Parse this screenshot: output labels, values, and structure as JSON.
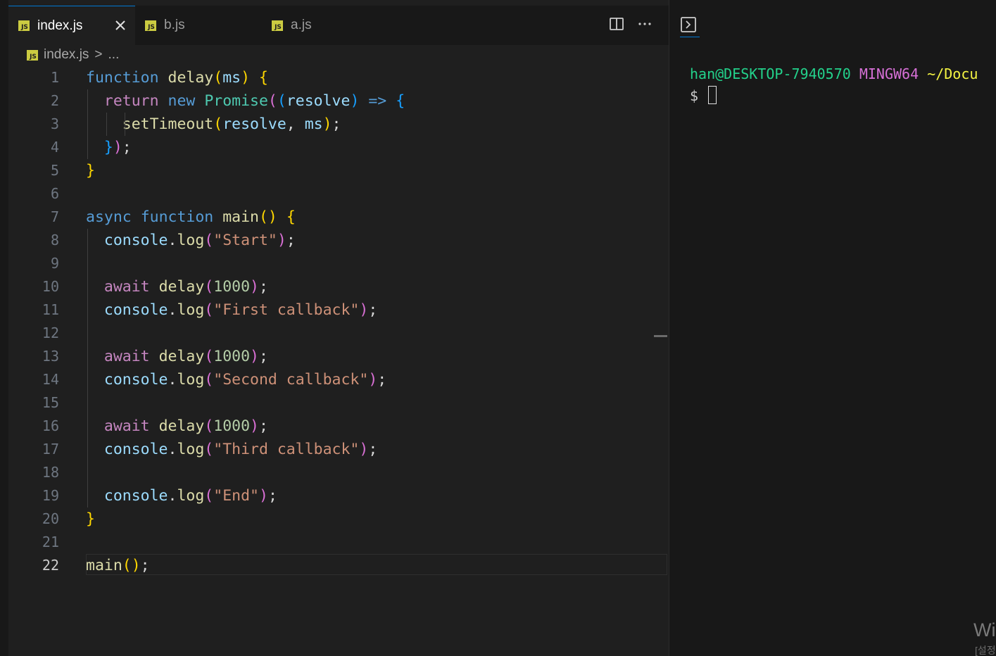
{
  "tabs": [
    {
      "label": "index.js",
      "icon": "js-file-icon",
      "active": true
    },
    {
      "label": "b.js",
      "icon": "js-file-icon",
      "active": false
    },
    {
      "label": "a.js",
      "icon": "js-file-icon",
      "active": false
    }
  ],
  "file_icon_text": "JS",
  "breadcrumb": {
    "file": "index.js",
    "separator": ">",
    "more": "..."
  },
  "editor": {
    "current_line": 22,
    "lines": [
      {
        "n": "1",
        "tokens": [
          [
            "kw",
            "function"
          ],
          [
            "pun",
            " "
          ],
          [
            "fn",
            "delay"
          ],
          [
            "b1",
            "("
          ],
          [
            "var",
            "ms"
          ],
          [
            "b1",
            ")"
          ],
          [
            "pun",
            " "
          ],
          [
            "b1",
            "{"
          ]
        ]
      },
      {
        "n": "2",
        "tokens": [
          [
            "pun",
            "  "
          ],
          [
            "ctl",
            "return"
          ],
          [
            "pun",
            " "
          ],
          [
            "kw",
            "new"
          ],
          [
            "pun",
            " "
          ],
          [
            "cls",
            "Promise"
          ],
          [
            "b2",
            "("
          ],
          [
            "b3",
            "("
          ],
          [
            "var",
            "resolve"
          ],
          [
            "b3",
            ")"
          ],
          [
            "pun",
            " "
          ],
          [
            "kw",
            "=>"
          ],
          [
            "pun",
            " "
          ],
          [
            "b3",
            "{"
          ]
        ]
      },
      {
        "n": "3",
        "tokens": [
          [
            "pun",
            "    "
          ],
          [
            "fn",
            "setTimeout"
          ],
          [
            "b1",
            "("
          ],
          [
            "var",
            "resolve"
          ],
          [
            "pun",
            ", "
          ],
          [
            "var",
            "ms"
          ],
          [
            "b1",
            ")"
          ],
          [
            "pun",
            ";"
          ]
        ]
      },
      {
        "n": "4",
        "tokens": [
          [
            "pun",
            "  "
          ],
          [
            "b3",
            "}"
          ],
          [
            "b2",
            ")"
          ],
          [
            "pun",
            ";"
          ]
        ]
      },
      {
        "n": "5",
        "tokens": [
          [
            "b1",
            "}"
          ]
        ]
      },
      {
        "n": "6",
        "tokens": []
      },
      {
        "n": "7",
        "tokens": [
          [
            "kw",
            "async"
          ],
          [
            "pun",
            " "
          ],
          [
            "kw",
            "function"
          ],
          [
            "pun",
            " "
          ],
          [
            "fn",
            "main"
          ],
          [
            "b1",
            "()"
          ],
          [
            "pun",
            " "
          ],
          [
            "b1",
            "{"
          ]
        ]
      },
      {
        "n": "8",
        "tokens": [
          [
            "pun",
            "  "
          ],
          [
            "var",
            "console"
          ],
          [
            "pun",
            "."
          ],
          [
            "fn",
            "log"
          ],
          [
            "b2",
            "("
          ],
          [
            "str",
            "\"Start\""
          ],
          [
            "b2",
            ")"
          ],
          [
            "pun",
            ";"
          ]
        ]
      },
      {
        "n": "9",
        "tokens": []
      },
      {
        "n": "10",
        "tokens": [
          [
            "pun",
            "  "
          ],
          [
            "ctl",
            "await"
          ],
          [
            "pun",
            " "
          ],
          [
            "fn",
            "delay"
          ],
          [
            "b2",
            "("
          ],
          [
            "num",
            "1000"
          ],
          [
            "b2",
            ")"
          ],
          [
            "pun",
            ";"
          ]
        ]
      },
      {
        "n": "11",
        "tokens": [
          [
            "pun",
            "  "
          ],
          [
            "var",
            "console"
          ],
          [
            "pun",
            "."
          ],
          [
            "fn",
            "log"
          ],
          [
            "b2",
            "("
          ],
          [
            "str",
            "\"First callback\""
          ],
          [
            "b2",
            ")"
          ],
          [
            "pun",
            ";"
          ]
        ]
      },
      {
        "n": "12",
        "tokens": []
      },
      {
        "n": "13",
        "tokens": [
          [
            "pun",
            "  "
          ],
          [
            "ctl",
            "await"
          ],
          [
            "pun",
            " "
          ],
          [
            "fn",
            "delay"
          ],
          [
            "b2",
            "("
          ],
          [
            "num",
            "1000"
          ],
          [
            "b2",
            ")"
          ],
          [
            "pun",
            ";"
          ]
        ]
      },
      {
        "n": "14",
        "tokens": [
          [
            "pun",
            "  "
          ],
          [
            "var",
            "console"
          ],
          [
            "pun",
            "."
          ],
          [
            "fn",
            "log"
          ],
          [
            "b2",
            "("
          ],
          [
            "str",
            "\"Second callback\""
          ],
          [
            "b2",
            ")"
          ],
          [
            "pun",
            ";"
          ]
        ]
      },
      {
        "n": "15",
        "tokens": []
      },
      {
        "n": "16",
        "tokens": [
          [
            "pun",
            "  "
          ],
          [
            "ctl",
            "await"
          ],
          [
            "pun",
            " "
          ],
          [
            "fn",
            "delay"
          ],
          [
            "b2",
            "("
          ],
          [
            "num",
            "1000"
          ],
          [
            "b2",
            ")"
          ],
          [
            "pun",
            ";"
          ]
        ]
      },
      {
        "n": "17",
        "tokens": [
          [
            "pun",
            "  "
          ],
          [
            "var",
            "console"
          ],
          [
            "pun",
            "."
          ],
          [
            "fn",
            "log"
          ],
          [
            "b2",
            "("
          ],
          [
            "str",
            "\"Third callback\""
          ],
          [
            "b2",
            ")"
          ],
          [
            "pun",
            ";"
          ]
        ]
      },
      {
        "n": "18",
        "tokens": []
      },
      {
        "n": "19",
        "tokens": [
          [
            "pun",
            "  "
          ],
          [
            "var",
            "console"
          ],
          [
            "pun",
            "."
          ],
          [
            "fn",
            "log"
          ],
          [
            "b2",
            "("
          ],
          [
            "str",
            "\"End\""
          ],
          [
            "b2",
            ")"
          ],
          [
            "pun",
            ";"
          ]
        ]
      },
      {
        "n": "20",
        "tokens": [
          [
            "b1",
            "}"
          ]
        ]
      },
      {
        "n": "21",
        "tokens": []
      },
      {
        "n": "22",
        "tokens": [
          [
            "fn",
            "main"
          ],
          [
            "b1",
            "()"
          ],
          [
            "pun",
            ";"
          ]
        ]
      }
    ]
  },
  "terminal": {
    "user": "han@DESKTOP-7940570",
    "env": "MINGW64",
    "path": "~/Docu",
    "prompt": "$"
  },
  "watermark": {
    "main": "Wi",
    "sub": "[설정"
  },
  "colors": {
    "accent": "#0078d4",
    "js_icon": "#cbcb41",
    "terminal_user": "#23d18b",
    "terminal_env": "#d670d6",
    "terminal_path": "#f5f543"
  }
}
